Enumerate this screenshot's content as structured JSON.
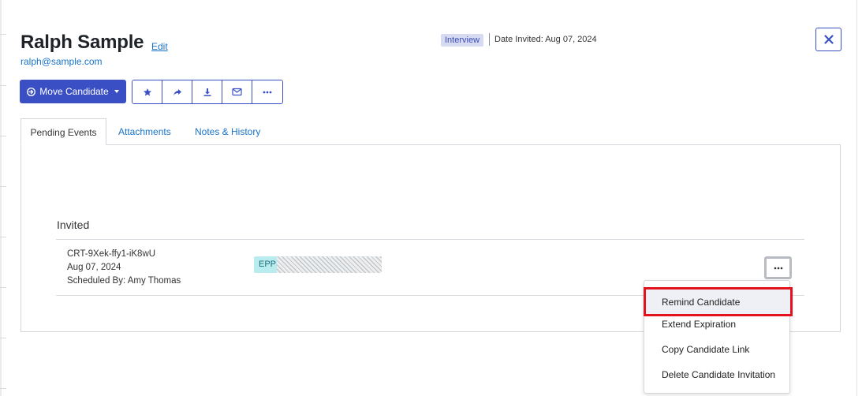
{
  "candidate": {
    "name": "Ralph Sample",
    "edit_label": "Edit",
    "email": "ralph@sample.com"
  },
  "status": {
    "stage_badge": "Interview",
    "date_invited": "Date Invited: Aug 07, 2024"
  },
  "actions": {
    "move_candidate_label": "Move Candidate",
    "icons": [
      "star-icon",
      "share-icon",
      "download-icon",
      "envelope-icon",
      "ellipsis-icon"
    ]
  },
  "tabs": [
    {
      "label": "Pending Events",
      "active": true
    },
    {
      "label": "Attachments",
      "active": false
    },
    {
      "label": "Notes & History",
      "active": false
    }
  ],
  "pending_events": {
    "section_heading": "Invited",
    "event": {
      "id": "CRT-9Xek-ffy1-iK8wU",
      "date": "Aug 07, 2024",
      "scheduled_by": "Scheduled By: Amy Thomas",
      "assessment_tag": "EPP",
      "progress_fraction": 0
    }
  },
  "context_menu": {
    "items": [
      "Remind Candidate",
      "Extend Expiration",
      "Copy Candidate Link",
      "Delete Candidate Invitation"
    ],
    "highlighted_index": 0
  },
  "colors": {
    "primary": "#3a4fc4",
    "link": "#1a73c8",
    "badge_bg": "#d7dbf2",
    "epp_bg": "#b9ecee",
    "highlight_border": "#e3121d"
  }
}
